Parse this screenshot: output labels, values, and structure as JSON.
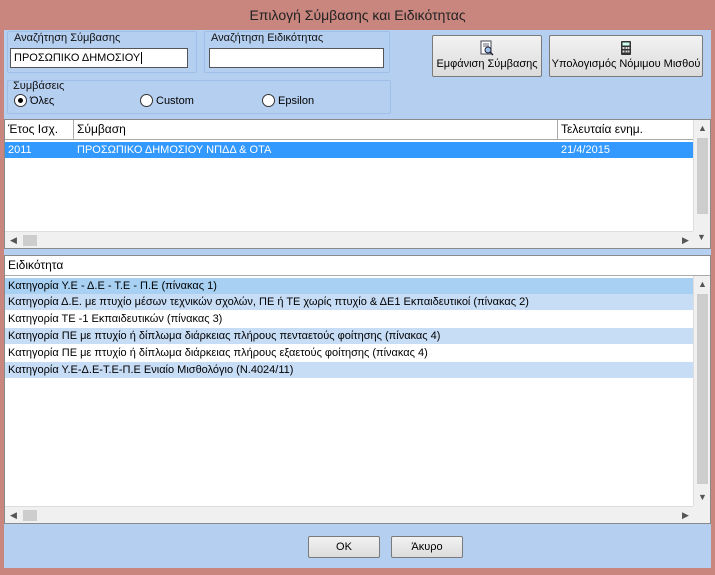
{
  "window": {
    "title": "Επιλογή Σύμβασης και Ειδικότητας"
  },
  "search": {
    "contract_label": "Αναζήτηση Σύμβασης",
    "contract_value": "ΠΡΟΣΩΠΙΚΟ ΔΗΜΟΣΙΟΥ",
    "specialty_label": "Αναζήτηση Ειδικότητας",
    "specialty_value": ""
  },
  "buttons": {
    "show_contract": "Εμφάνιση Σύμβασης",
    "calc_salary": "Υπολογισμός Νόμιμου Μισθού",
    "ok": "ΟΚ",
    "cancel": "Άκυρο"
  },
  "contracts_filter": {
    "label": "Συμβάσεις",
    "options": [
      {
        "label": "Όλες",
        "selected": true
      },
      {
        "label": "Custom",
        "selected": false
      },
      {
        "label": "Epsilon",
        "selected": false
      }
    ]
  },
  "contracts_table": {
    "columns": [
      "Έτος Ισχ.",
      "Σύμβαση",
      "Τελευταία ενημ."
    ],
    "rows": [
      {
        "year": "2011",
        "contract": "ΠΡΟΣΩΠΙΚΟ ΔΗΜΟΣΙΟΥ ΝΠΔΔ & ΟΤΑ",
        "updated": "21/4/2015"
      }
    ]
  },
  "specialty_table": {
    "column": "Ειδικότητα",
    "rows": [
      "Κατηγορία Υ.Ε - Δ.Ε - Τ.Ε - Π.Ε (πίνακας 1)",
      "Κατηγορία Δ.Ε. με πτυχίο μέσων τεχνικών σχολών, ΠΕ ή ΤΕ χωρίς πτυχίο & ΔΕ1 Εκπαιδευτικοί (πίνακας 2)",
      "Κατηγορία ΤΕ -1 Εκπαιδευτικών (πίνακας 3)",
      "Κατηγορία ΠΕ με πτυχίο ή δίπλωμα διάρκειας πλήρους πενταετούς φοίτησης (πίνακας 4)",
      "Κατηγορία ΠΕ  με πτυχίο ή δίπλωμα διάρκειας πλήρους εξαετούς φοίτησης (πίνακας 4)",
      "Κατηγορία Υ.Ε-Δ.Ε-Τ.Ε-Π.Ε Ενιαίο Μισθολόγιο (Ν.4024/11)"
    ]
  },
  "colors": {
    "title_bar": "#c9867f",
    "client": "#b5cff0",
    "selection": "#3399ff",
    "row_alt": "#c7dcf5"
  }
}
